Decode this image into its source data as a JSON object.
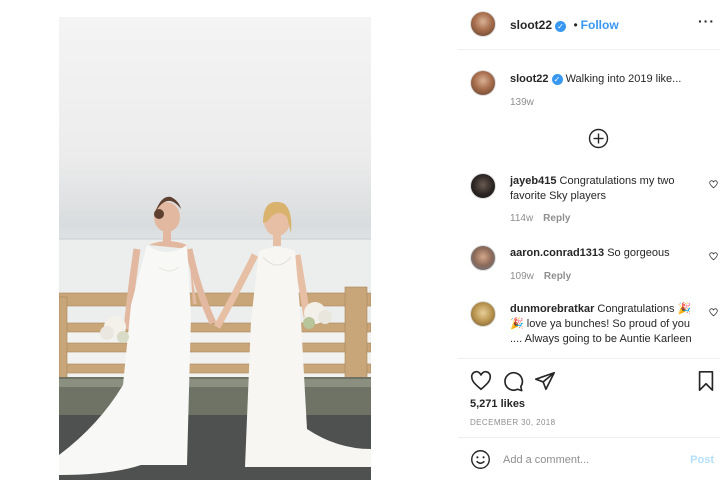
{
  "post": {
    "username": "sloot22",
    "follow_label": "Follow",
    "separator": "•",
    "caption": "Walking into 2019 like...",
    "caption_time": "139w",
    "likes": "5,271 likes",
    "date": "DECEMBER 30, 2018"
  },
  "comments": [
    {
      "username": "jayeb415",
      "text": "Congratulations my two favorite Sky players",
      "time": "114w",
      "reply": "Reply"
    },
    {
      "username": "aaron.conrad1313",
      "text": "So gorgeous",
      "time": "109w",
      "reply": "Reply"
    },
    {
      "username": "dunmorebratkar",
      "text": "Congratulations 🎉🎉 love ya bunches! So proud of you .... Always going to be Auntie Karleen",
      "time": "",
      "reply": ""
    }
  ],
  "composer": {
    "placeholder": "Add a comment...",
    "post_label": "Post"
  },
  "icons": {
    "more": "more-options-icon",
    "load_more": "load-more-icon",
    "like": "heart-icon",
    "comment": "comment-icon",
    "share": "share-icon",
    "save": "bookmark-icon",
    "emoji": "emoji-icon"
  },
  "colors": {
    "link_blue": "#3897f0",
    "muted": "#8e8e8e",
    "post_disabled": "#b2dffc"
  }
}
